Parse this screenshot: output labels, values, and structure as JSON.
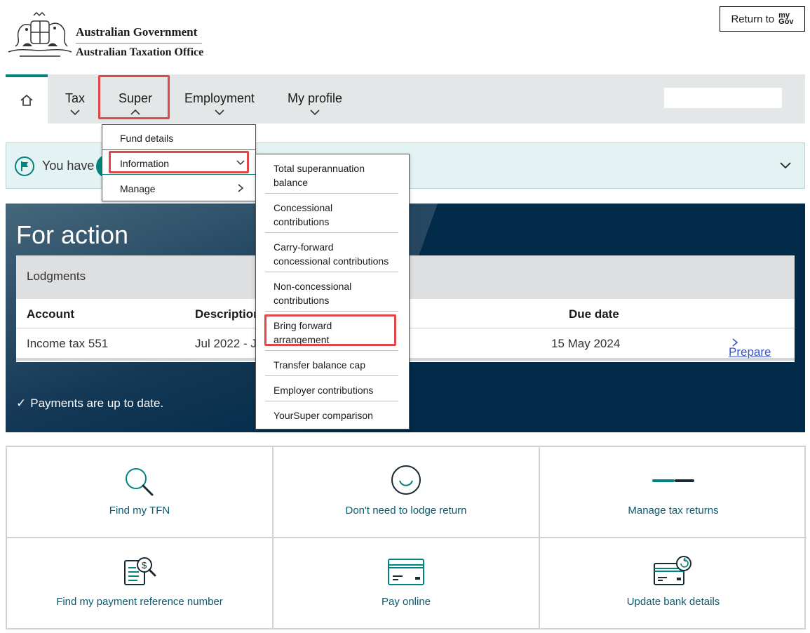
{
  "header": {
    "gov_line1": "Australian Government",
    "gov_line2": "Australian Taxation Office",
    "return_label": "Return to",
    "mygov_top": "my",
    "mygov_bottom": "Gov"
  },
  "nav": {
    "items": [
      {
        "label": "Tax"
      },
      {
        "label": "Super"
      },
      {
        "label": "Employment"
      },
      {
        "label": "My profile"
      }
    ]
  },
  "notice": {
    "text": "You have"
  },
  "super_menu": {
    "items": [
      {
        "label": "Fund details"
      },
      {
        "label": "Information"
      },
      {
        "label": "Manage"
      }
    ]
  },
  "info_menu": {
    "items": [
      {
        "label": "Total superannuation balance"
      },
      {
        "label": "Concessional contributions"
      },
      {
        "label": "Carry-forward concessional contributions"
      },
      {
        "label": "Non-concessional contributions"
      },
      {
        "label": "Bring forward arrangement"
      },
      {
        "label": "Transfer balance cap"
      },
      {
        "label": "Employer contributions"
      },
      {
        "label": "YourSuper comparison"
      }
    ]
  },
  "for_action": {
    "title": "For action",
    "lodgments_title": "Lodgments",
    "columns": {
      "account": "Account",
      "description": "Description",
      "due_date": "Due date"
    },
    "row": {
      "account": "Income tax 551",
      "description": "Jul 2022 - J",
      "due_date": "15 May 2024",
      "action": "Prepare"
    },
    "payments_status": "Payments are up to date."
  },
  "tiles": [
    {
      "label": "Find my TFN",
      "icon": "magnifier-icon"
    },
    {
      "label": "Don't need to lodge return",
      "icon": "smiley-icon"
    },
    {
      "label": "Manage tax returns",
      "icon": "progress-line-icon"
    },
    {
      "label": "Find my payment reference number",
      "icon": "document-search-icon"
    },
    {
      "label": "Pay online",
      "icon": "credit-card-icon"
    },
    {
      "label": "Update bank details",
      "icon": "card-refresh-icon"
    }
  ],
  "colors": {
    "accent": "#00847d",
    "highlight": "#e04848",
    "panel": "#012b48",
    "link": "#3956c4"
  }
}
